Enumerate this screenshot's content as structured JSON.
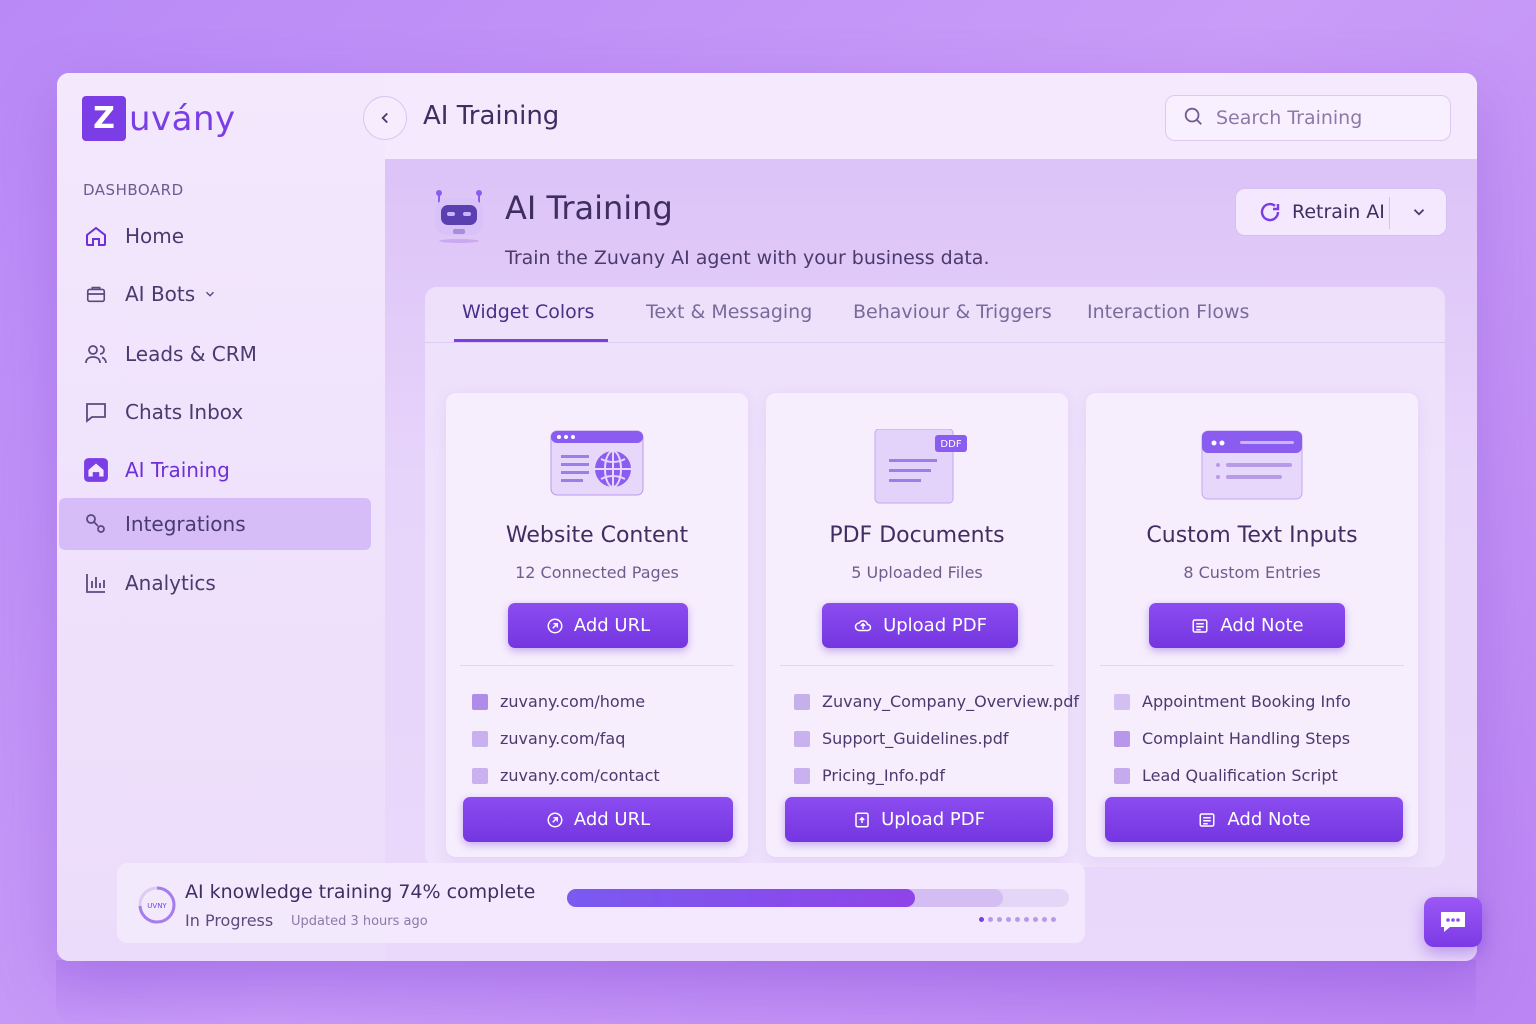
{
  "brand": {
    "logo_letter": "Z",
    "logo_text": "uvány"
  },
  "sidebar": {
    "section_label": "DASHBOARD",
    "items": [
      {
        "label": "Home",
        "icon": "home-icon"
      },
      {
        "label": "AI Bots",
        "icon": "briefcase-icon"
      },
      {
        "label": "Leads & CRM",
        "icon": "users-icon"
      },
      {
        "label": "Chats Inbox",
        "icon": "chat-icon"
      },
      {
        "label": "AI Training",
        "icon": "training-icon"
      },
      {
        "label": "Integrations",
        "icon": "integrations-icon"
      },
      {
        "label": "Analytics",
        "icon": "analytics-icon"
      }
    ]
  },
  "header": {
    "title": "AI Training",
    "search_placeholder": "Search Training"
  },
  "page": {
    "title": "AI Training",
    "subtitle": "Train the Zuvany AI agent with your business data.",
    "retrain_label": "Retrain AI"
  },
  "tabs": [
    {
      "label": "Widget Colors"
    },
    {
      "label": "Text & Messaging"
    },
    {
      "label": "Behaviour & Triggers"
    },
    {
      "label": "Interaction Flows"
    }
  ],
  "cards": [
    {
      "title": "Website Content",
      "subtitle": "12 Connected Pages",
      "primary_button": "Add URL",
      "footer_button": "Add URL",
      "items": [
        "zuvany.com/home",
        "zuvany.com/faq",
        "zuvany.com/contact"
      ]
    },
    {
      "title": "PDF Documents",
      "subtitle": "5 Uploaded Files",
      "badge": "DDF",
      "primary_button": "Upload PDF",
      "footer_button": "Upload PDF",
      "items": [
        "Zuvany_Company_Overview.pdf",
        "Support_Guidelines.pdf",
        "Pricing_Info.pdf"
      ]
    },
    {
      "title": "Custom Text Inputs",
      "subtitle": "8 Custom Entries",
      "primary_button": "Add Note",
      "footer_button": "Add Note",
      "items": [
        "Appointment Booking Info",
        "Complaint Handling Steps",
        "Lead Qualification Script"
      ]
    }
  ],
  "progress": {
    "title": "AI knowledge training 74% complete",
    "status": "In Progress",
    "updated": "Updated 3 hours ago",
    "ring_label": "UVNY",
    "percent": 74
  },
  "colors": {
    "accent": "#7a3de6",
    "background": "#c99cf8"
  }
}
